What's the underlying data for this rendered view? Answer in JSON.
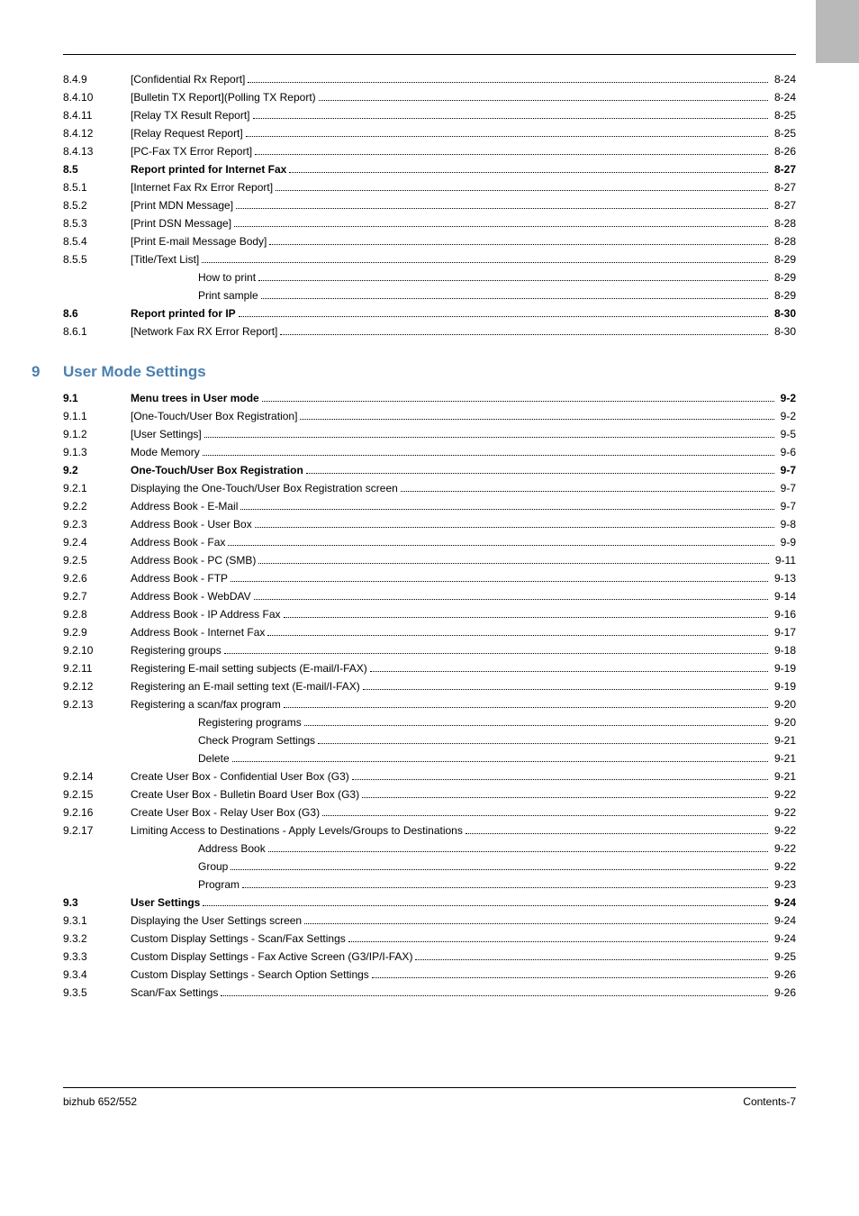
{
  "corner": true,
  "section8": [
    {
      "num": "8.4.9",
      "title": "[Confidential Rx Report]",
      "page": "8-24"
    },
    {
      "num": "8.4.10",
      "title": "[Bulletin TX Report](Polling TX Report)",
      "page": "8-24"
    },
    {
      "num": "8.4.11",
      "title": "[Relay TX Result Report]",
      "page": "8-25"
    },
    {
      "num": "8.4.12",
      "title": "[Relay Request Report]",
      "page": "8-25"
    },
    {
      "num": "8.4.13",
      "title": "[PC-Fax TX Error Report]",
      "page": "8-26"
    },
    {
      "num": "8.5",
      "title": "Report printed for Internet Fax",
      "page": "8-27",
      "bold": true
    },
    {
      "num": "8.5.1",
      "title": "[Internet Fax Rx Error Report]",
      "page": "8-27"
    },
    {
      "num": "8.5.2",
      "title": "[Print MDN Message]",
      "page": "8-27"
    },
    {
      "num": "8.5.3",
      "title": "[Print DSN Message]",
      "page": "8-28"
    },
    {
      "num": "8.5.4",
      "title": "[Print E-mail Message Body]",
      "page": "8-28"
    },
    {
      "num": "8.5.5",
      "title": "[Title/Text List]",
      "page": "8-29"
    },
    {
      "num": "",
      "title": "How to print",
      "page": "8-29",
      "sub": true
    },
    {
      "num": "",
      "title": "Print sample",
      "page": "8-29",
      "sub": true
    },
    {
      "num": "8.6",
      "title": "Report printed for IP",
      "page": "8-30",
      "bold": true
    },
    {
      "num": "8.6.1",
      "title": "[Network Fax RX Error Report]",
      "page": "8-30"
    }
  ],
  "chapter9": {
    "num": "9",
    "title": "User Mode Settings"
  },
  "section9": [
    {
      "num": "9.1",
      "title": "Menu trees in User mode",
      "page": "9-2",
      "bold": true
    },
    {
      "num": "9.1.1",
      "title": "[One-Touch/User Box Registration]",
      "page": "9-2"
    },
    {
      "num": "9.1.2",
      "title": "[User Settings]",
      "page": "9-5"
    },
    {
      "num": "9.1.3",
      "title": "Mode Memory",
      "page": "9-6"
    },
    {
      "num": "9.2",
      "title": "One-Touch/User Box Registration",
      "page": "9-7",
      "bold": true
    },
    {
      "num": "9.2.1",
      "title": "Displaying the One-Touch/User Box Registration screen",
      "page": "9-7"
    },
    {
      "num": "9.2.2",
      "title": "Address Book - E-Mail",
      "page": "9-7"
    },
    {
      "num": "9.2.3",
      "title": "Address Book - User Box",
      "page": "9-8"
    },
    {
      "num": "9.2.4",
      "title": "Address Book - Fax",
      "page": "9-9"
    },
    {
      "num": "9.2.5",
      "title": "Address Book - PC (SMB)",
      "page": "9-11"
    },
    {
      "num": "9.2.6",
      "title": "Address Book - FTP",
      "page": "9-13"
    },
    {
      "num": "9.2.7",
      "title": "Address Book - WebDAV",
      "page": "9-14"
    },
    {
      "num": "9.2.8",
      "title": "Address Book - IP Address Fax",
      "page": "9-16"
    },
    {
      "num": "9.2.9",
      "title": "Address Book - Internet Fax",
      "page": "9-17"
    },
    {
      "num": "9.2.10",
      "title": "Registering groups",
      "page": "9-18"
    },
    {
      "num": "9.2.11",
      "title": "Registering E-mail setting subjects (E-mail/I-FAX)",
      "page": "9-19"
    },
    {
      "num": "9.2.12",
      "title": "Registering an E-mail setting text (E-mail/I-FAX)",
      "page": "9-19"
    },
    {
      "num": "9.2.13",
      "title": "Registering a scan/fax program",
      "page": "9-20"
    },
    {
      "num": "",
      "title": "Registering programs",
      "page": "9-20",
      "sub": true
    },
    {
      "num": "",
      "title": "Check Program Settings",
      "page": "9-21",
      "sub": true
    },
    {
      "num": "",
      "title": "Delete",
      "page": "9-21",
      "sub": true
    },
    {
      "num": "9.2.14",
      "title": "Create User Box - Confidential User Box (G3)",
      "page": "9-21"
    },
    {
      "num": "9.2.15",
      "title": "Create User Box - Bulletin Board User Box (G3)",
      "page": "9-22"
    },
    {
      "num": "9.2.16",
      "title": "Create User Box - Relay User Box (G3)",
      "page": "9-22"
    },
    {
      "num": "9.2.17",
      "title": "Limiting Access to Destinations - Apply Levels/Groups to Destinations",
      "page": "9-22"
    },
    {
      "num": "",
      "title": "Address Book",
      "page": "9-22",
      "sub": true
    },
    {
      "num": "",
      "title": "Group",
      "page": "9-22",
      "sub": true
    },
    {
      "num": "",
      "title": "Program",
      "page": "9-23",
      "sub": true
    },
    {
      "num": "9.3",
      "title": "User Settings",
      "page": "9-24",
      "bold": true
    },
    {
      "num": "9.3.1",
      "title": "Displaying the User Settings screen",
      "page": "9-24"
    },
    {
      "num": "9.3.2",
      "title": "Custom Display Settings - Scan/Fax Settings",
      "page": "9-24"
    },
    {
      "num": "9.3.3",
      "title": "Custom Display Settings - Fax Active Screen (G3/IP/I-FAX)",
      "page": "9-25"
    },
    {
      "num": "9.3.4",
      "title": "Custom Display Settings - Search Option Settings",
      "page": "9-26"
    },
    {
      "num": "9.3.5",
      "title": "Scan/Fax Settings",
      "page": "9-26"
    }
  ],
  "footer": {
    "left": "bizhub 652/552",
    "right": "Contents-7"
  }
}
